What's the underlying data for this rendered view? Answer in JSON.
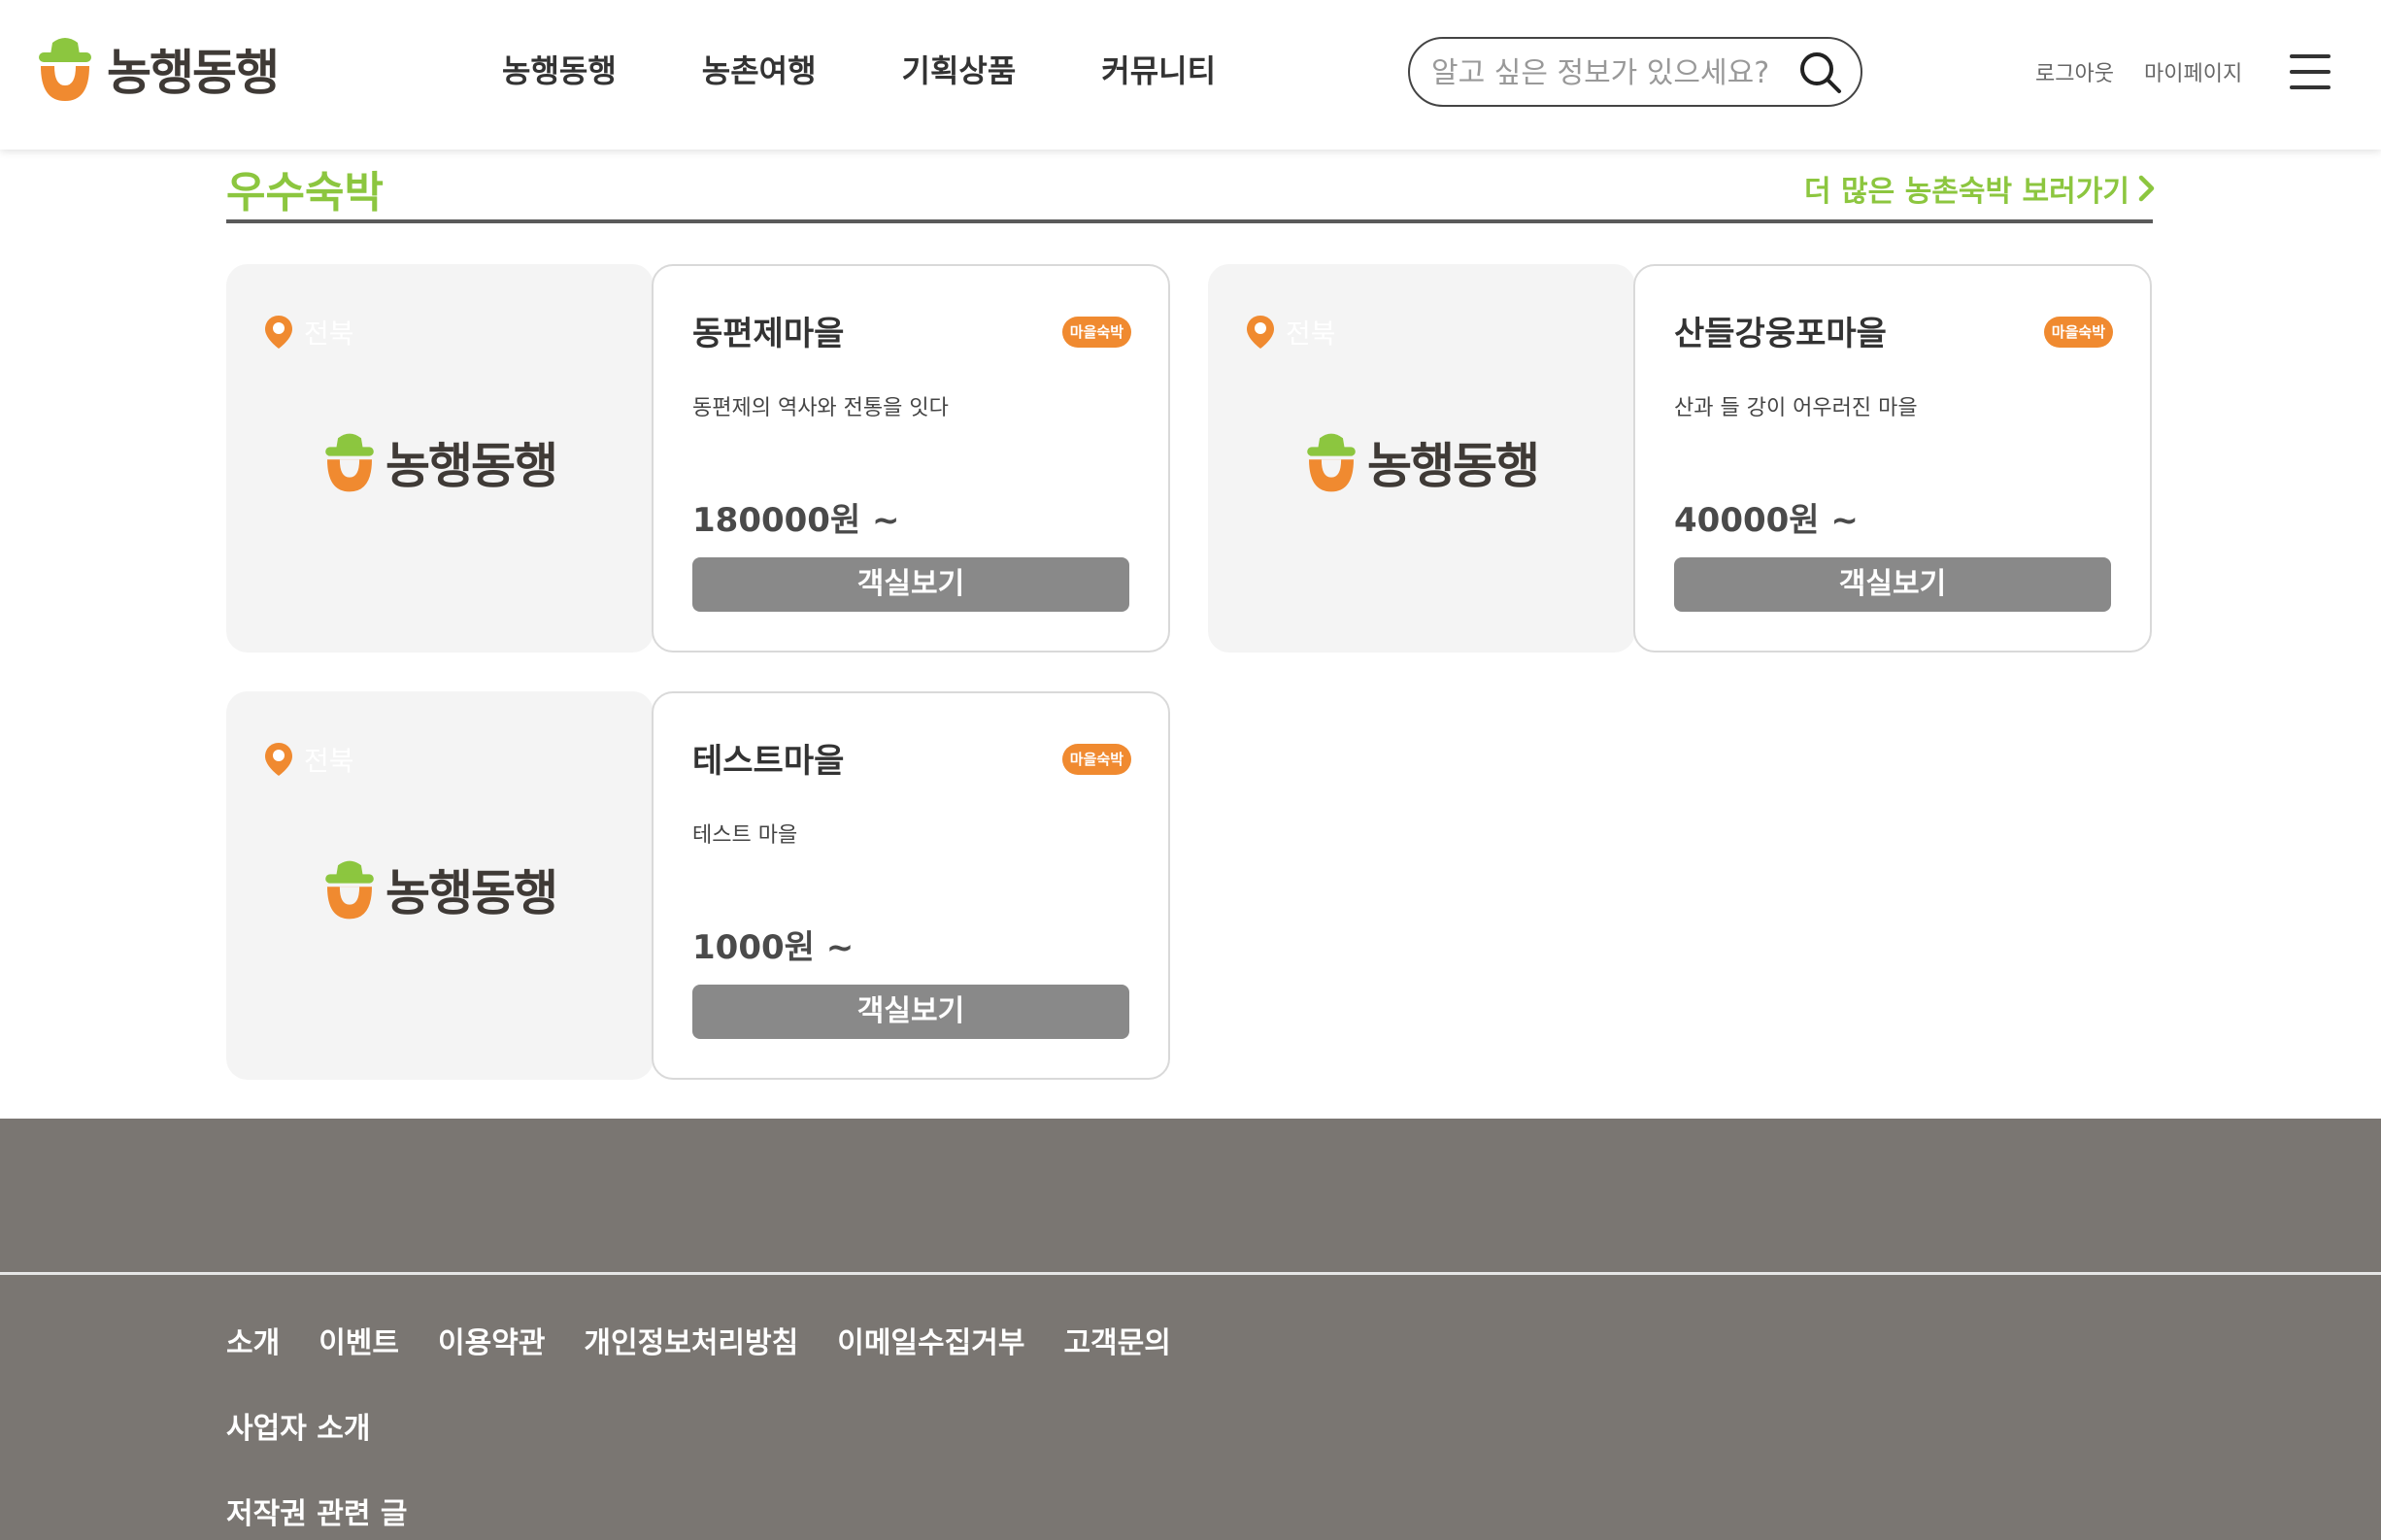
{
  "header": {
    "logo_text": "농행동행",
    "nav": [
      "농행동행",
      "농촌여행",
      "기획상품",
      "커뮤니티"
    ],
    "search_placeholder": "알고 싶은 정보가 있으세요?",
    "logout": "로그아웃",
    "mypage": "마이페이지"
  },
  "section": {
    "title": "우수숙박",
    "more_link": "더 많은 농촌숙박 보러가기"
  },
  "cards": [
    {
      "region": "전북",
      "logo_text": "농행동행",
      "name": "동편제마을",
      "badge": "마을숙박",
      "description": "동편제의 역사와 전통을 잇다",
      "price": "180000원 ~",
      "button": "객실보기"
    },
    {
      "region": "전북",
      "logo_text": "농행동행",
      "name": "산들강웅포마을",
      "badge": "마을숙박",
      "description": "산과 들 강이 어우러진 마을",
      "price": "40000원 ~",
      "button": "객실보기"
    },
    {
      "region": "전북",
      "logo_text": "농행동행",
      "name": "테스트마을",
      "badge": "마을숙박",
      "description": "테스트 마을",
      "price": "1000원 ~",
      "button": "객실보기"
    }
  ],
  "footer": {
    "links": [
      "소개",
      "이벤트",
      "이용약관",
      "개인정보처리방침",
      "이메일수집거부",
      "고객문의"
    ],
    "business": "사업자 소개",
    "copyright": "저작권 관련 글"
  },
  "colors": {
    "brand_green": "#8cc63f",
    "brand_orange": "#f08a30",
    "button_gray": "#898989",
    "footer_bg": "#7a7672"
  }
}
